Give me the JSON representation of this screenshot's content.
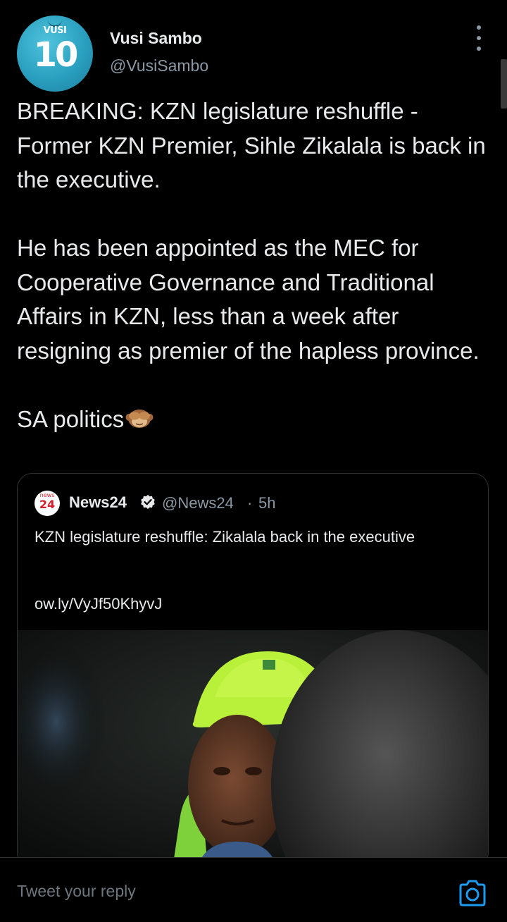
{
  "author": {
    "name": "Vusi Sambo",
    "handle": "@VusiSambo",
    "avatar_label": "VUSI",
    "avatar_number": "10"
  },
  "tweet": {
    "text": "BREAKING: KZN legislature reshuffle - Former KZN Premier, Sihle Zikalala is back in the executive.\n\nHe has been appointed as the MEC for Cooperative Governance and Traditional Affairs in KZN, less than a week after resigning as premier of the hapless province.\n\nSA politics",
    "emoji_icon": "see-no-evil-monkey-icon"
  },
  "quoted_tweet": {
    "logo_top": "news",
    "logo_number": "24",
    "name": "News24",
    "handle": "@News24",
    "separator": "·",
    "time": "5h",
    "text": "KZN legislature reshuffle: Zikalala back in the executive",
    "link": "ow.ly/VyJf50KhyvJ"
  },
  "reply_bar": {
    "placeholder": "Tweet your reply",
    "camera_icon": "camera-icon"
  },
  "colors": {
    "background": "#000000",
    "text_primary": "#e7e9ea",
    "text_secondary": "#8b98a5",
    "accent": "#1d9bf0",
    "border": "#2f3336"
  }
}
